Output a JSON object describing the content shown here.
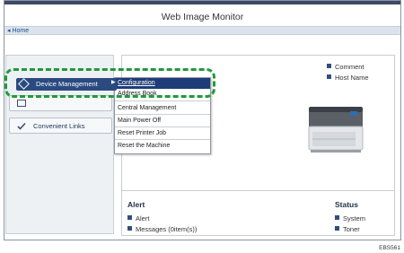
{
  "header": {
    "title": "Web Image Monitor",
    "home_link": "Home"
  },
  "sidebar": {
    "items": [
      {
        "label": "Device Management"
      },
      {
        "label": "Convenient Links"
      }
    ]
  },
  "menu": {
    "items": [
      "Configuration",
      "Address Book",
      "Central Management",
      "Main Power Off",
      "Reset Printer Job",
      "Reset the Machine"
    ]
  },
  "device_info": {
    "comment": "Comment",
    "host_name": "Host Name"
  },
  "alert": {
    "heading": "Alert",
    "items": [
      "Alert",
      "Messages (0item(s))"
    ]
  },
  "status": {
    "heading": "Status",
    "items": [
      "System",
      "Toner"
    ]
  },
  "figure_code": "EBS561",
  "colors": {
    "menu_blue": "#1e3d78",
    "highlight_green": "#1f9a3b",
    "topline": "#3c4a66"
  }
}
